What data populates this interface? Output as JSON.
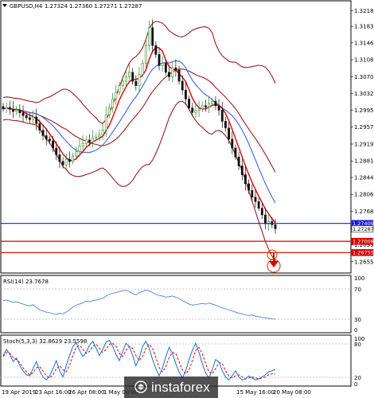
{
  "header": {
    "symbol": "GBPUSD,H4",
    "ohlc": "1.27324 1.27360 1.27271 1.27287"
  },
  "price_axis": {
    "labels": [
      "1.32180",
      "1.31830",
      "1.31460",
      "1.31080",
      "1.30700",
      "1.30320",
      "1.29950",
      "1.29570",
      "1.29190",
      "1.28810",
      "1.28440",
      "1.28060",
      "1.27680",
      "1.27287",
      "1.26930",
      "1.26550"
    ],
    "tags": [
      {
        "label": "1.27409",
        "value": 1.27409,
        "color": "#1a1ad6"
      },
      {
        "label": "1.27287",
        "value": 1.27287,
        "color": "#ffffff"
      },
      {
        "label": "1.27008",
        "value": 1.27008,
        "color": "#d80000"
      },
      {
        "label": "1.26755",
        "value": 1.26755,
        "color": "#d80000"
      }
    ]
  },
  "time_axis": {
    "labels": [
      "19 Apr 2019",
      "23 Apr 16:00",
      "26 Apr 08:00",
      "1 May 00:00",
      "15 May 16:00",
      "20 May 08:00"
    ]
  },
  "rsi": {
    "title": "RSI(14) 23.7678",
    "levels": [
      "100",
      "70",
      "30",
      "0"
    ]
  },
  "stoch": {
    "title": "Stoch(5,3,3) 32.8629 23.5598",
    "levels": [
      "100",
      "80",
      "20",
      "0"
    ]
  },
  "watermark": {
    "text": "instaforex",
    "icon": "instaforex-logo-icon"
  },
  "colors": {
    "bull": "#2e8b2e",
    "bear": "#111111",
    "fast_ma": "#e00000",
    "slow_ma": "#4a6fe0",
    "bands": "#9b1b1b",
    "rsi": "#5b8fe0",
    "stoch_main": "#1a6dd6",
    "stoch_signal": "#e00000",
    "support": "#d80000",
    "resistance": "#1a1ad6"
  },
  "chart_data": {
    "type": "candlestick",
    "symbol": "GBPUSD",
    "timeframe": "H4",
    "ylim": [
      1.2635,
      1.3235
    ],
    "close": [
      1.2998,
      1.3001,
      1.2997,
      1.2992,
      1.2995,
      1.2989,
      1.2983,
      1.2978,
      1.2974,
      1.298,
      1.2965,
      1.295,
      1.2938,
      1.293,
      1.2926,
      1.291,
      1.2895,
      1.288,
      1.2872,
      1.2885,
      1.288,
      1.2892,
      1.2902,
      1.2915,
      1.292,
      1.2928,
      1.2924,
      1.2933,
      1.2935,
      1.294,
      1.295,
      1.2985,
      1.3,
      1.302,
      1.3035,
      1.305,
      1.306,
      1.307,
      1.308,
      1.306,
      1.305,
      1.3075,
      1.31,
      1.314,
      1.318,
      1.314,
      1.312,
      1.3095,
      1.31,
      1.308,
      1.307,
      1.309,
      1.3085,
      1.306,
      1.304,
      1.302,
      1.3,
      1.299,
      1.2995,
      1.2998,
      1.3005,
      1.3002,
      1.301,
      1.3015,
      1.3005,
      1.2995,
      1.297,
      1.2955,
      1.293,
      1.291,
      1.289,
      1.287,
      1.285,
      1.283,
      1.2815,
      1.28,
      1.279,
      1.2775,
      1.276,
      1.274,
      1.2745,
      1.2738,
      1.2729
    ],
    "rsi_values": [
      56,
      57,
      55,
      53,
      54,
      52,
      50,
      48,
      47,
      49,
      44,
      40,
      38,
      36,
      35,
      33,
      32,
      34,
      33,
      36,
      40,
      45,
      48,
      50,
      52,
      55,
      54,
      56,
      57,
      58,
      60,
      64,
      67,
      69,
      70,
      72,
      73,
      74,
      72,
      68,
      66,
      70,
      72,
      74,
      73,
      70,
      67,
      65,
      64,
      62,
      63,
      64,
      62,
      60,
      56,
      53,
      50,
      48,
      49,
      50,
      51,
      50,
      52,
      50,
      48,
      46,
      43,
      42,
      40,
      38,
      36,
      34,
      33,
      31,
      30,
      31,
      29,
      28,
      27,
      26,
      25,
      24,
      23.77
    ],
    "stoch_main": [
      60,
      72,
      62,
      48,
      55,
      40,
      30,
      22,
      20,
      34,
      48,
      30,
      18,
      12,
      20,
      34,
      50,
      30,
      18,
      40,
      60,
      78,
      85,
      70,
      58,
      66,
      80,
      88,
      74,
      60,
      72,
      86,
      90,
      78,
      62,
      50,
      68,
      84,
      78,
      60,
      40,
      55,
      78,
      88,
      74,
      52,
      34,
      20,
      36,
      58,
      76,
      64,
      44,
      28,
      16,
      30,
      52,
      70,
      84,
      66,
      44,
      26,
      16,
      32,
      52,
      48,
      30,
      18,
      12,
      20,
      30,
      18,
      12,
      14,
      20,
      16,
      12,
      14,
      18,
      22,
      28,
      30,
      32.86
    ],
    "stoch_signal": [
      58,
      66,
      64,
      56,
      52,
      46,
      36,
      28,
      22,
      26,
      36,
      38,
      30,
      20,
      16,
      22,
      34,
      40,
      32,
      28,
      40,
      60,
      76,
      80,
      72,
      64,
      68,
      78,
      82,
      74,
      66,
      72,
      82,
      84,
      78,
      64,
      58,
      70,
      78,
      74,
      60,
      50,
      58,
      74,
      82,
      74,
      56,
      36,
      28,
      38,
      56,
      66,
      64,
      48,
      32,
      24,
      32,
      50,
      70,
      76,
      64,
      44,
      28,
      24,
      34,
      46,
      44,
      30,
      20,
      16,
      20,
      22,
      18,
      14,
      16,
      18,
      16,
      14,
      16,
      18,
      22,
      24,
      23.56
    ],
    "levels": [
      1.27409,
      1.27008,
      1.26755
    ]
  }
}
